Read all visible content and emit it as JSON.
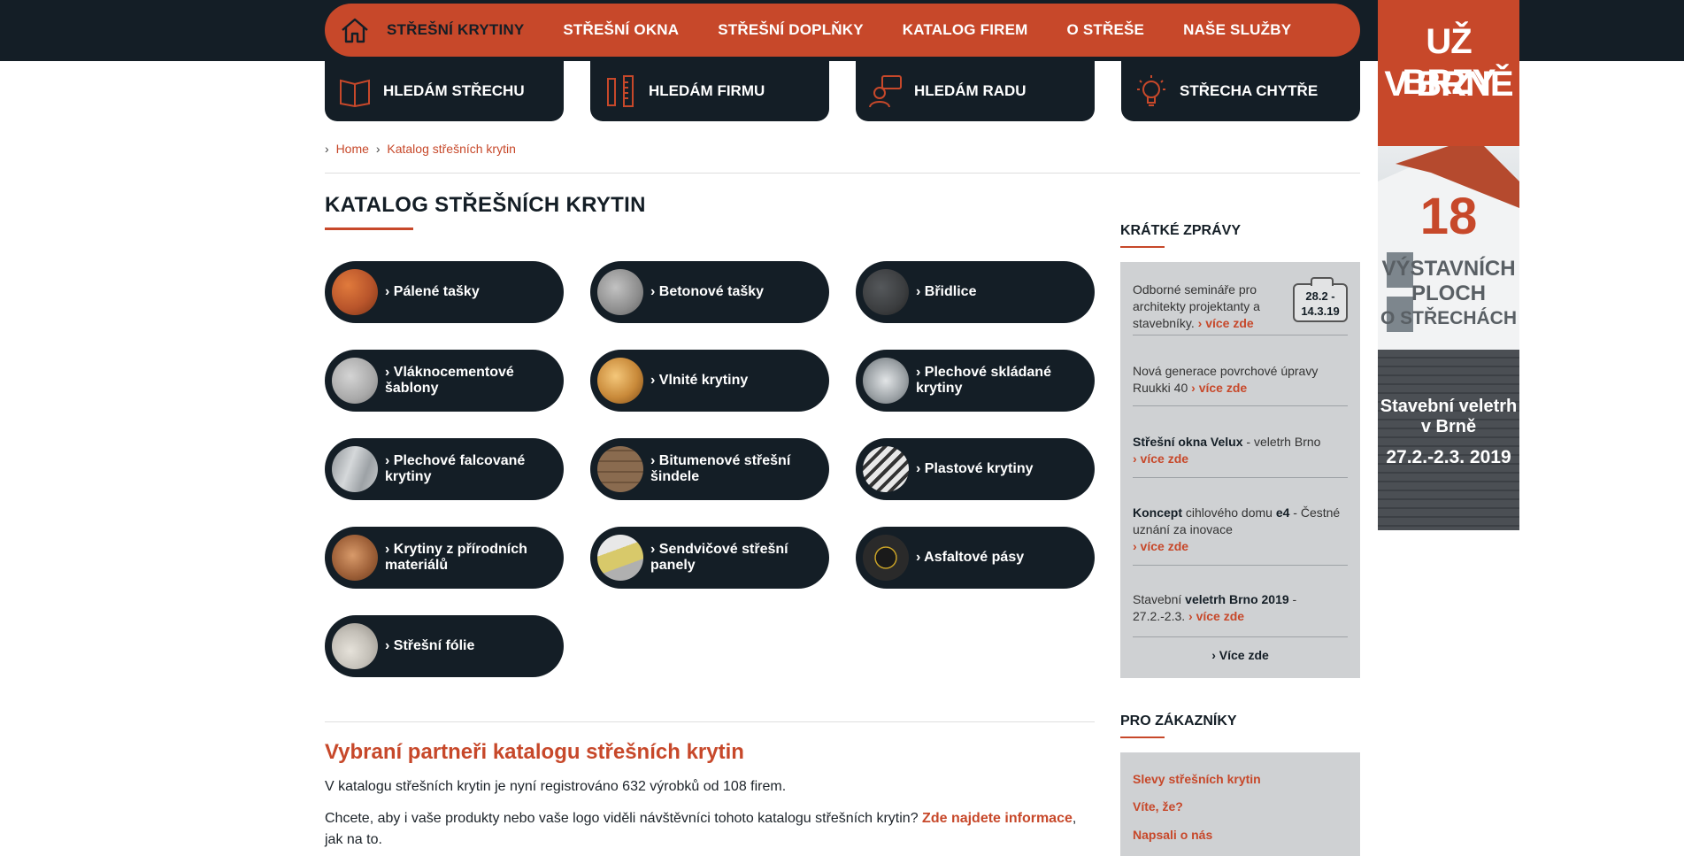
{
  "nav": {
    "items": [
      {
        "label": "Střešní krytiny",
        "active": true
      },
      {
        "label": "Střešní okna",
        "active": false
      },
      {
        "label": "Střešní doplňky",
        "active": false
      },
      {
        "label": "Katalog firem",
        "active": false
      },
      {
        "label": "O střeše",
        "active": false
      },
      {
        "label": "Naše služby",
        "active": false
      }
    ]
  },
  "subnav": [
    {
      "label": "Hledám střechu",
      "icon": "book-icon"
    },
    {
      "label": "Hledám firmu",
      "icon": "tools-icon"
    },
    {
      "label": "Hledám radu",
      "icon": "advice-icon"
    },
    {
      "label": "Střecha chytře",
      "icon": "lightbulb-icon"
    }
  ],
  "breadcrumb": {
    "home": "Home",
    "current": "Katalog střešních krytin",
    "sep": "›"
  },
  "page_title": "Katalog střešních krytin",
  "categories": [
    {
      "label": "› Pálené tašky",
      "color": "#b9552b"
    },
    {
      "label": "› Betonové tašky",
      "color": "#8d8d8d"
    },
    {
      "label": "› Břidlice",
      "color": "#3b3d3f"
    },
    {
      "label": "› Vláknocementové šablony",
      "color": "#a9a9a9"
    },
    {
      "label": "› Vlnité krytiny",
      "color": "#c98a3a"
    },
    {
      "label": "› Plechové skládané krytiny",
      "color": "#9aa0a4"
    },
    {
      "label": "› Plechové falcované krytiny",
      "color": "#b7bbbe"
    },
    {
      "label": "› Bitumenové střešní šindele",
      "color": "#8a6b4f"
    },
    {
      "label": "› Plastové krytiny",
      "color": "#d8d8d8"
    },
    {
      "label": "› Krytiny z přírodních materiálů",
      "color": "#a0623a"
    },
    {
      "label": "› Sendvičové střešní panely",
      "color": "#d8c96a"
    },
    {
      "label": "› Asfaltové pásy",
      "color": "#2a2a2a"
    },
    {
      "label": "› Střešní fólie",
      "color": "#c4c0b8"
    }
  ],
  "partners": {
    "title": "Vybraní partneři katalogu střešních krytin",
    "text1": "V katalogu střešních krytin je nyní registrováno 632 výrobků od 108 firem.",
    "text2_before": "Chcete, aby i vaše produkty nebo vaše logo viděli návštěvníci tohoto katalogu střešních krytin? ",
    "text2_link": "Zde najdete informace",
    "text2_after": ", jak na to."
  },
  "news": {
    "heading": "Krátké zprávy",
    "date_badge": {
      "line1": "28.2 -",
      "line2": "14.3.19"
    },
    "items": [
      {
        "prefix_bold": "",
        "text": "Odborné semináře pro architekty projektanty a stavebníky.",
        "more": " › více zde"
      },
      {
        "prefix_bold": "",
        "text": "Nová generace povrchové úpravy Ruukki 40",
        "more": " › více zde"
      },
      {
        "prefix_bold": "Střešní okna Velux",
        "text": " - veletrh Brno",
        "more": "› více zde"
      },
      {
        "prefix_bold": "Koncept",
        "text": " cihlového domu ",
        "bold2": "e4",
        "text2": " - Čestné uznání za inovace",
        "more": "› více zde"
      },
      {
        "prefix_bold": "",
        "text": "Stavební ",
        "bold2": "veletrh Brno 2019",
        "text2": " - 27.2.-2.3.",
        "more": " › více zde"
      }
    ],
    "all": "› Více zde"
  },
  "customers": {
    "heading": "Pro zákazníky",
    "links": [
      "Slevy střešních krytin",
      "Víte, že?",
      "Napsali o nás"
    ]
  },
  "banner": {
    "line1": "UŽ BRZY",
    "line2": "V BRNĚ",
    "num": "18",
    "l3": "VÝSTAVNÍCH",
    "l4": "PLOCH",
    "l5": "O STŘECHÁCH",
    "l6": "Stavební veletrh",
    "l7": "v Brně",
    "l8": "27.2.-2.3. 2019"
  },
  "colors": {
    "accent": "#c7482a",
    "dark": "#141e26",
    "panel": "#cfd1d3"
  }
}
